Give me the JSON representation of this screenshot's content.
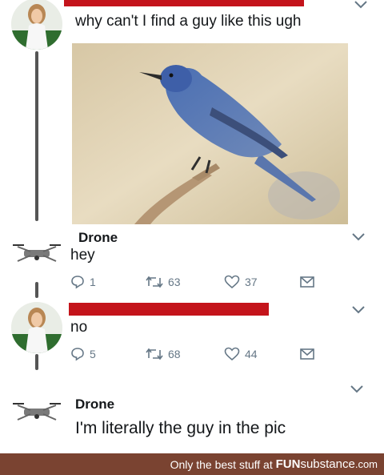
{
  "tweet1": {
    "text": "why can't I find a guy like this ugh",
    "image_alt": "blue bird perched on a branch"
  },
  "reply1": {
    "author": "Drone",
    "text": "hey",
    "actions": {
      "replies": "1",
      "retweets": "63",
      "likes": "37"
    }
  },
  "reply2": {
    "text": "no",
    "actions": {
      "replies": "5",
      "retweets": "68",
      "likes": "44"
    }
  },
  "reply3": {
    "author": "Drone",
    "text": "I'm literally the guy in the pic"
  },
  "footer": {
    "prefix": "Only the best stuff at ",
    "brand_bold": "FUN",
    "brand_rest": "substance",
    "brand_tld": ".com"
  },
  "colors": {
    "redaction": "#c4141b",
    "footer_bg": "#7a4331",
    "icon_gray": "#657786",
    "thread_line": "#555555"
  },
  "icons": [
    "chevron-down-icon",
    "reply-icon",
    "retweet-icon",
    "like-icon",
    "share-icon",
    "drone-avatar-icon",
    "woman-avatar-icon"
  ]
}
